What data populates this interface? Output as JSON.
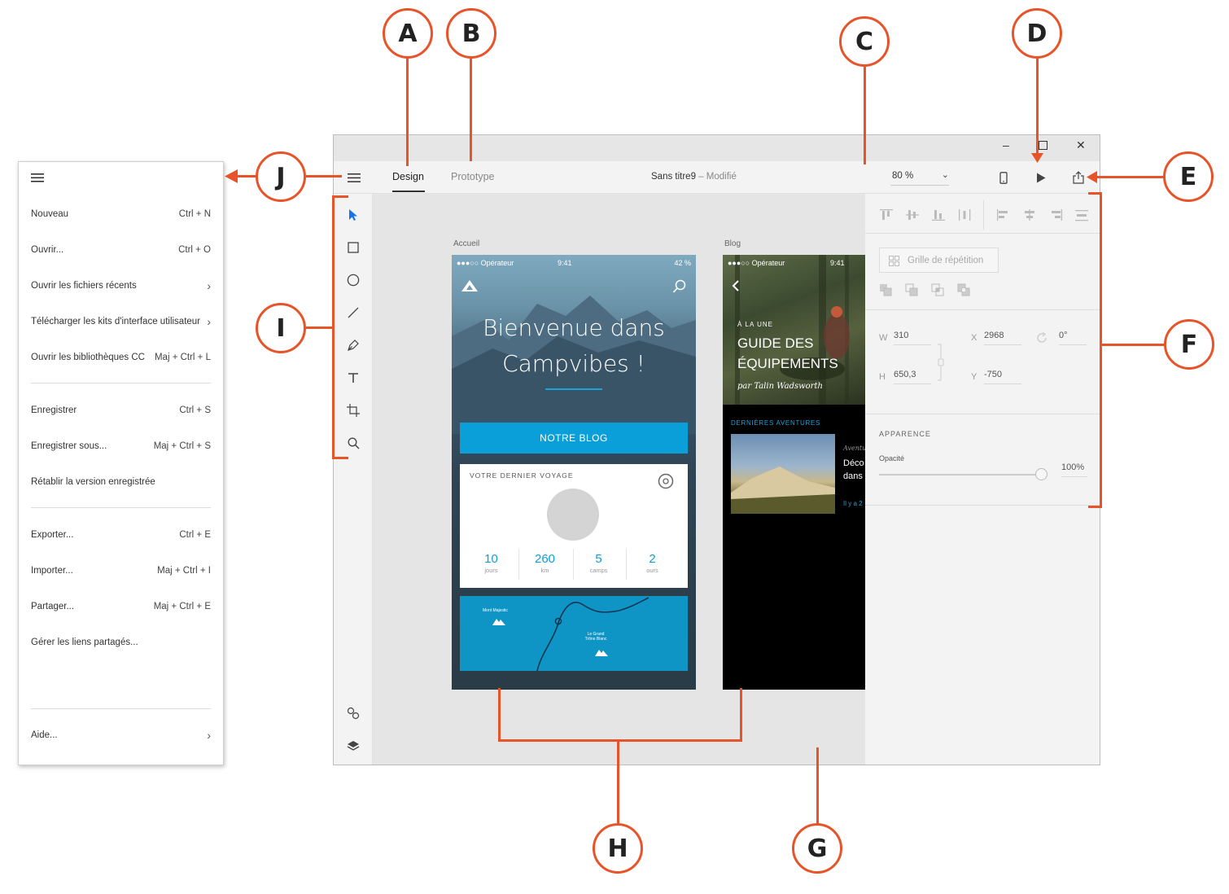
{
  "callouts": [
    "A",
    "B",
    "C",
    "D",
    "E",
    "F",
    "G",
    "H",
    "I",
    "J"
  ],
  "accent_color": "#e8542a",
  "menu": {
    "items": [
      {
        "label": "Nouveau",
        "shortcut": "Ctrl + N"
      },
      {
        "label": "Ouvrir...",
        "shortcut": "Ctrl + O"
      },
      {
        "label": "Ouvrir les fichiers récents",
        "shortcut": ""
      },
      {
        "label": "Télécharger les kits d'interface utilisateur",
        "shortcut": ""
      },
      {
        "label": "Ouvrir les bibliothèques CC",
        "shortcut": "Maj + Ctrl + L"
      },
      {
        "label": "Enregistrer",
        "shortcut": "Ctrl + S"
      },
      {
        "label": "Enregistrer sous...",
        "shortcut": "Maj + Ctrl + S"
      },
      {
        "label": "Rétablir la version enregistrée",
        "shortcut": ""
      },
      {
        "label": "Exporter...",
        "shortcut": "Ctrl + E"
      },
      {
        "label": "Importer...",
        "shortcut": "Maj + Ctrl + I"
      },
      {
        "label": "Partager...",
        "shortcut": "Maj + Ctrl + E"
      },
      {
        "label": "Gérer les liens partagés...",
        "shortcut": ""
      },
      {
        "label": "Aide...",
        "shortcut": ""
      }
    ]
  },
  "appbar": {
    "tabs": [
      "Design",
      "Prototype"
    ],
    "doc_name": "Sans titre9",
    "doc_sep": "–",
    "doc_status": "Modifié",
    "zoom": "80 %"
  },
  "artboards": {
    "home": {
      "label": "Accueil",
      "status_left": "●●●○○ Opérateur",
      "status_time": "9:41",
      "status_right": "42 %",
      "welcome_line1": "Bienvenue dans",
      "welcome_line2": "Campvibes !",
      "blog_button": "NOTRE BLOG",
      "trip_title": "VOTRE DERNIER VOYAGE",
      "stats": [
        {
          "value": "10",
          "unit": "jours"
        },
        {
          "value": "260",
          "unit": "km"
        },
        {
          "value": "5",
          "unit": "camps"
        },
        {
          "value": "2",
          "unit": "ours"
        }
      ],
      "map_label_1": "Mont Majestic",
      "map_label_2": "Le Grand Trône Blanc"
    },
    "blog": {
      "label": "Blog",
      "status_left": "●●●○○ Opérateur",
      "status_time": "9:41",
      "kicker": "À LA UNE",
      "title_line1": "GUIDE DES",
      "title_line2": "ÉQUIPEMENTS",
      "byline": "par Talin Wadsworth",
      "section": "DERNIÈRES AVENTURES",
      "card_kicker": "Aventu",
      "card_line1": "Déco",
      "card_line2": "dans",
      "card_meta": "Il y a 2"
    }
  },
  "props": {
    "repeat_grid": "Grille de répétition",
    "w_label": "W",
    "w_value": "310",
    "h_label": "H",
    "h_value": "650,3",
    "x_label": "X",
    "x_value": "2968",
    "y_label": "Y",
    "y_value": "-750",
    "rotation": "0°",
    "appearance": "APPARENCE",
    "opacity_label": "Opacité",
    "opacity_value": "100%",
    "opacity_level": 1.0
  }
}
